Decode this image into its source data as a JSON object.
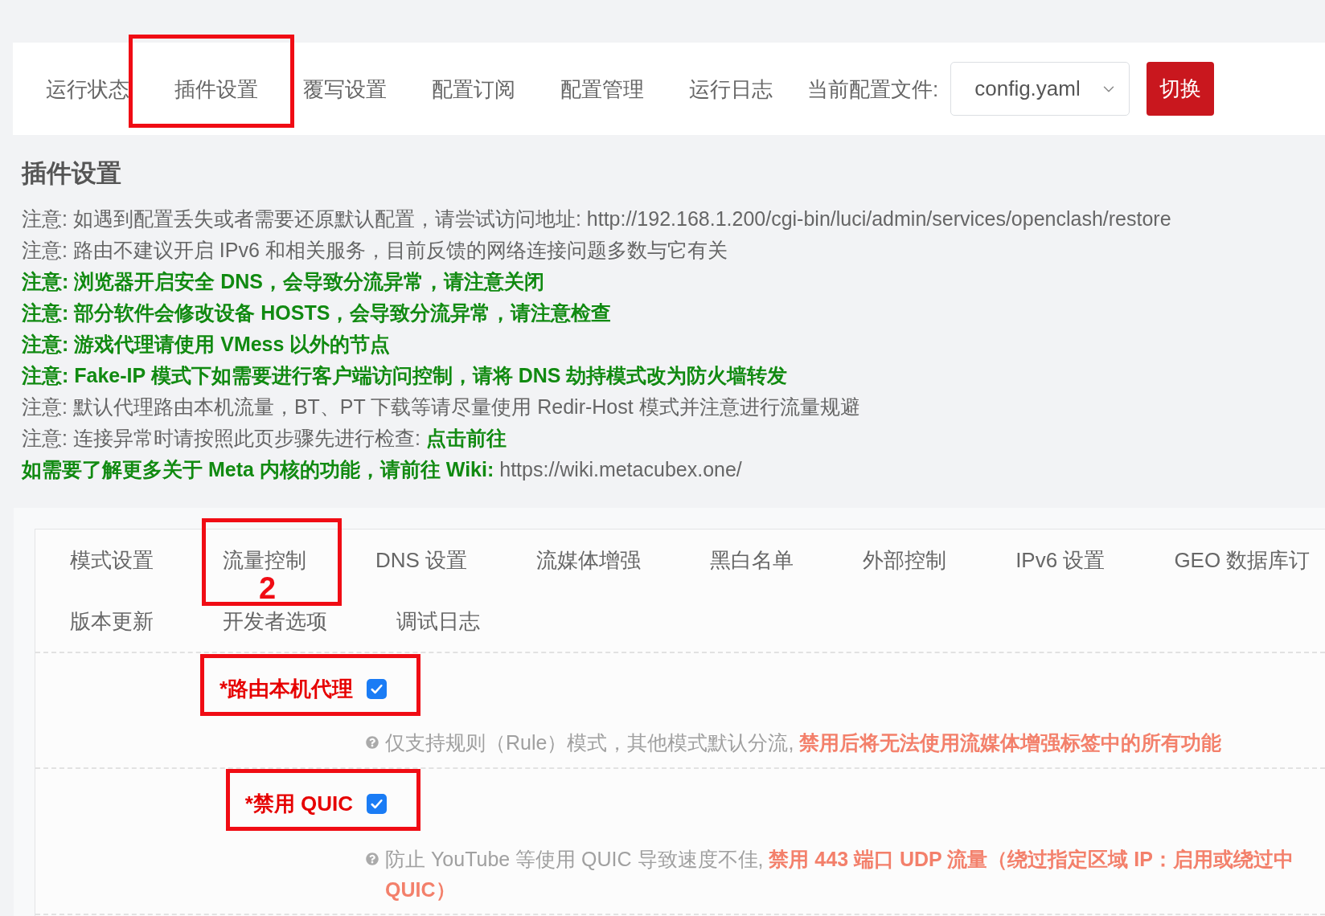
{
  "nav_bar": {
    "tabs": [
      {
        "label": "运行状态",
        "annotated": false
      },
      {
        "label": "插件设置",
        "annotated": true
      },
      {
        "label": "覆写设置",
        "annotated": false
      },
      {
        "label": "配置订阅",
        "annotated": false
      },
      {
        "label": "配置管理",
        "annotated": false
      },
      {
        "label": "运行日志",
        "annotated": false
      }
    ],
    "config_label": "当前配置文件:",
    "config_select": {
      "value": "config.yaml"
    },
    "switch_button": {
      "label": "切换"
    }
  },
  "page_title": "插件设置",
  "notices": [
    {
      "parts": [
        {
          "emphasis": false,
          "text": "注意: 如遇到配置丢失或者需要还原默认配置，请尝试访问地址: http://192.168.1.200/cgi-bin/luci/admin/services/openclash/restore"
        }
      ]
    },
    {
      "parts": [
        {
          "emphasis": false,
          "text": "注意: 路由不建议开启 IPv6 和相关服务，目前反馈的网络连接问题多数与它有关"
        }
      ]
    },
    {
      "parts": [
        {
          "emphasis": true,
          "text": "注意: 浏览器开启安全 DNS，会导致分流异常，请注意关闭"
        }
      ]
    },
    {
      "parts": [
        {
          "emphasis": true,
          "text": "注意: 部分软件会修改设备 HOSTS，会导致分流异常，请注意检查"
        }
      ]
    },
    {
      "parts": [
        {
          "emphasis": true,
          "text": "注意: 游戏代理请使用 VMess 以外的节点"
        }
      ]
    },
    {
      "parts": [
        {
          "emphasis": true,
          "text": "注意: Fake-IP 模式下如需要进行客户端访问控制，请将 DNS 劫持模式改为防火墙转发"
        }
      ]
    },
    {
      "parts": [
        {
          "emphasis": false,
          "text": "注意: 默认代理路由本机流量，BT、PT 下载等请尽量使用 Redir-Host 模式并注意进行流量规避"
        }
      ]
    },
    {
      "parts": [
        {
          "emphasis": false,
          "text": "注意: 连接异常时请按照此页步骤先进行检查: "
        },
        {
          "emphasis": true,
          "text": "点击前往"
        }
      ]
    },
    {
      "parts": [
        {
          "emphasis": true,
          "text": "如需要了解更多关于 Meta 内核的功能，请前往 Wiki: "
        },
        {
          "emphasis": false,
          "text": "https://wiki.metacubex.one/"
        }
      ]
    }
  ],
  "settings_panel": {
    "tab_rows": [
      [
        {
          "label": "模式设置",
          "annotated": false
        },
        {
          "label": "流量控制",
          "annotated": true,
          "annotation_label": "2"
        },
        {
          "label": "DNS 设置",
          "annotated": false
        },
        {
          "label": "流媒体增强",
          "annotated": false
        },
        {
          "label": "黑白名单",
          "annotated": false
        },
        {
          "label": "外部控制",
          "annotated": false
        },
        {
          "label": "IPv6 设置",
          "annotated": false
        },
        {
          "label": "GEO 数据库订",
          "annotated": false
        }
      ],
      [
        {
          "label": "版本更新",
          "annotated": false
        },
        {
          "label": "开发者选项",
          "annotated": false
        },
        {
          "label": "调试日志",
          "annotated": false
        }
      ]
    ],
    "options": [
      {
        "label": "*路由本机代理",
        "checked": true,
        "annotated": true,
        "description": {
          "lines": [
            [
              {
                "emphasis": false,
                "text": "仅支持规则（Rule）模式，其他模式默认分流, "
              },
              {
                "emphasis": true,
                "text": "禁用后将无法使用流媒体增强标签中的所有功能"
              }
            ]
          ]
        }
      },
      {
        "label": "*禁用 QUIC",
        "checked": true,
        "annotated": true,
        "description": {
          "lines": [
            [
              {
                "emphasis": false,
                "text": "防止 YouTube 等使用 QUIC 导致速度不佳, "
              },
              {
                "emphasis": true,
                "text": "禁用 443 端口 UDP 流量（绕过指定区域 IP：启用或绕过中"
              }
            ],
            [
              {
                "emphasis": true,
                "text": "QUIC）"
              }
            ]
          ]
        }
      }
    ]
  }
}
